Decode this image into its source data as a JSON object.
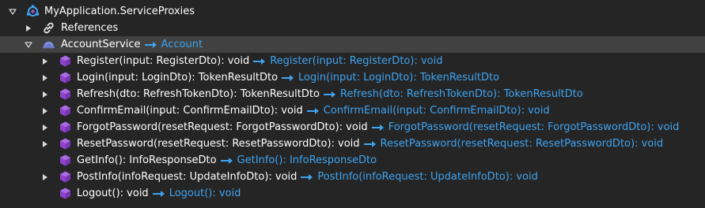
{
  "tree": {
    "root": {
      "label": "MyApplication.ServiceProxies",
      "icon": "service-proxies-icon"
    },
    "references": {
      "label": "References",
      "icon": "link-icon"
    },
    "service": {
      "label": "AccountService",
      "target": "Account",
      "icon": "service-icon"
    },
    "operations": [
      {
        "label": "Register(input: RegisterDto): void",
        "target": "Register(input: RegisterDto): void",
        "has_children": true
      },
      {
        "label": "Login(input: LoginDto): TokenResultDto",
        "target": "Login(input: LoginDto): TokenResultDto",
        "has_children": true
      },
      {
        "label": "Refresh(dto: RefreshTokenDto): TokenResultDto",
        "target": "Refresh(dto: RefreshTokenDto): TokenResultDto",
        "has_children": true
      },
      {
        "label": "ConfirmEmail(input: ConfirmEmailDto): void",
        "target": "ConfirmEmail(input: ConfirmEmailDto): void",
        "has_children": true
      },
      {
        "label": "ForgotPassword(resetRequest: ForgotPasswordDto): void",
        "target": "ForgotPassword(resetRequest: ForgotPasswordDto): void",
        "has_children": true
      },
      {
        "label": "ResetPassword(resetRequest: ResetPasswordDto): void",
        "target": "ResetPassword(resetRequest: ResetPasswordDto): void",
        "has_children": true
      },
      {
        "label": "GetInfo(): InfoResponseDto",
        "target": "GetInfo(): InfoResponseDto",
        "has_children": false
      },
      {
        "label": "PostInfo(infoRequest: UpdateInfoDto): void",
        "target": "PostInfo(infoRequest: UpdateInfoDto): void",
        "has_children": true
      },
      {
        "label": "Logout(): void",
        "target": "Logout(): void",
        "has_children": false
      }
    ]
  },
  "colors": {
    "background": "#252526",
    "selected_row": "#414141",
    "text": "#ffffff",
    "mapping_target": "#3fa4ef",
    "operation_icon": "#8e44c9"
  }
}
